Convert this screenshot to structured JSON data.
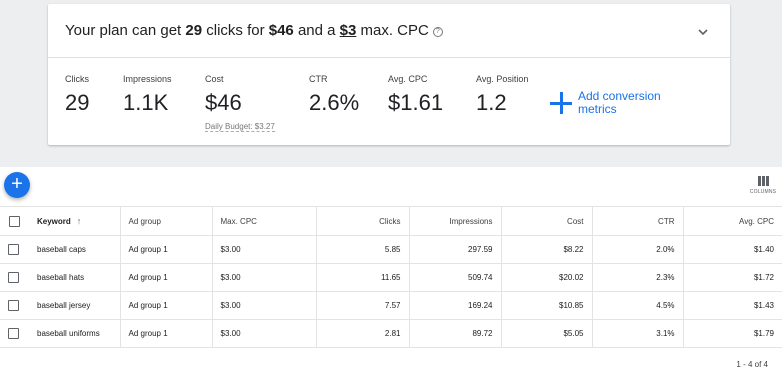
{
  "summary": {
    "headline_prefix": "Your plan can get ",
    "clicks": "29",
    "headline_mid1": " clicks for ",
    "cost": "$46",
    "headline_mid2": " and a ",
    "max_cpc": "$3",
    "headline_suffix": " max. CPC",
    "help_icon": "?"
  },
  "metrics": [
    {
      "label": "Clicks",
      "value": "29"
    },
    {
      "label": "Impressions",
      "value": "1.1K"
    },
    {
      "label": "Cost",
      "value": "$46",
      "sub": "Daily Budget: $3.27"
    },
    {
      "label": "CTR",
      "value": "2.6%"
    },
    {
      "label": "Avg. CPC",
      "value": "$1.61"
    },
    {
      "label": "Avg. Position",
      "value": "1.2"
    }
  ],
  "add_conversion": "Add conversion metrics",
  "toolbar": {
    "fab": "+",
    "columns_label": "COLUMNS"
  },
  "table": {
    "headers": [
      "Keyword",
      "Ad group",
      "Max. CPC",
      "Clicks",
      "Impressions",
      "Cost",
      "CTR",
      "Avg. CPC"
    ],
    "rows": [
      [
        "baseball caps",
        "Ad group 1",
        "$3.00",
        "5.85",
        "297.59",
        "$8.22",
        "2.0%",
        "$1.40"
      ],
      [
        "baseball hats",
        "Ad group 1",
        "$3.00",
        "11.65",
        "509.74",
        "$20.02",
        "2.3%",
        "$1.72"
      ],
      [
        "baseball jersey",
        "Ad group 1",
        "$3.00",
        "7.57",
        "169.24",
        "$10.85",
        "4.5%",
        "$1.43"
      ],
      [
        "baseball uniforms",
        "Ad group 1",
        "$3.00",
        "2.81",
        "89.72",
        "$5.05",
        "3.1%",
        "$1.79"
      ]
    ]
  },
  "pager": "1 - 4 of 4"
}
